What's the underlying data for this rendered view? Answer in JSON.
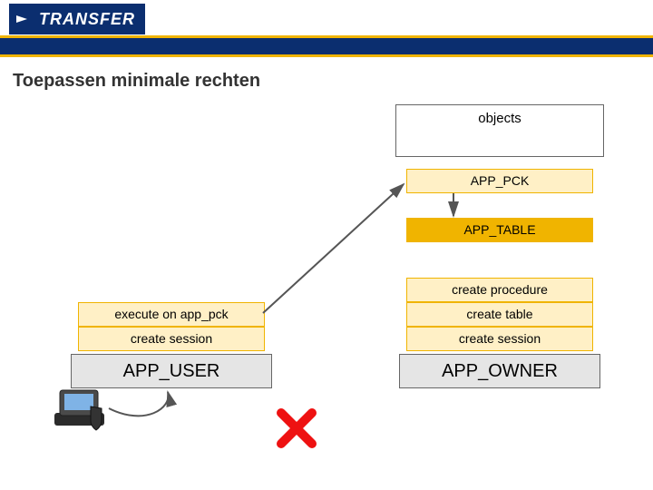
{
  "logo": {
    "text": "TRANSFER"
  },
  "title": "Toepassen minimale rechten",
  "objects": {
    "label": "objects"
  },
  "boxes": {
    "pck": "APP_PCK",
    "tbl": "APP_TABLE",
    "create_procedure": "create procedure",
    "create_table": "create table",
    "create_session": "create session",
    "execute_on_pck": "execute on app_pck"
  },
  "roles": {
    "user": "APP_USER",
    "owner": "APP_OWNER"
  }
}
